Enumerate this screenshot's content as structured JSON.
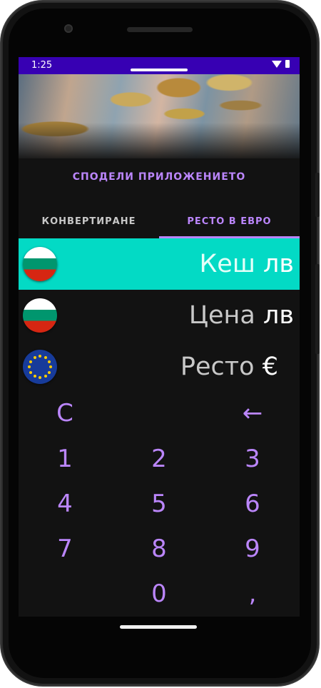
{
  "status_bar": {
    "time": "1:25"
  },
  "share_label": "СПОДЕЛИ ПРИЛОЖЕНИЕТО",
  "tabs": [
    {
      "label": "КОНВЕРТИРАНЕ",
      "selected": false
    },
    {
      "label": "РЕСТО В ЕВРО",
      "selected": true
    }
  ],
  "rows": [
    {
      "label": "Кеш",
      "unit": "лв",
      "flag": "bulgaria-flag-icon",
      "active": true
    },
    {
      "label": "Цена",
      "unit": "лв",
      "flag": "bulgaria-flag-icon",
      "active": false
    },
    {
      "label": "Ресто",
      "unit": "€",
      "flag": "eu-flag-icon",
      "active": false
    }
  ],
  "keypad": {
    "clear": "C",
    "backspace": "←",
    "digits": [
      "1",
      "2",
      "3",
      "4",
      "5",
      "6",
      "7",
      "8",
      "9"
    ],
    "zero": "0",
    "comma": ","
  },
  "colors": {
    "accent": "#bb86fc",
    "status_bar": "#3700b3",
    "active_row": "#03dac5",
    "background": "#121212"
  }
}
